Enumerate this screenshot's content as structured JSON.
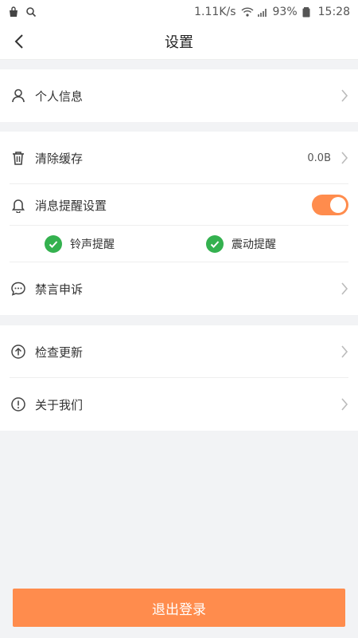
{
  "status_bar": {
    "speed": "1.11K/s",
    "battery": "93%",
    "time": "15:28",
    "icons": [
      "shopping-bag-icon",
      "search-icon",
      "wifi-icon",
      "signal-icon",
      "battery-icon"
    ]
  },
  "header": {
    "title": "设置"
  },
  "groups": {
    "profile": {
      "label": "个人信息"
    },
    "cache": {
      "label": "清除缓存",
      "value": "0.0B"
    },
    "notifications": {
      "label": "消息提醒设置",
      "toggle_on": true,
      "options": [
        {
          "label": "铃声提醒",
          "checked": true
        },
        {
          "label": "震动提醒",
          "checked": true
        }
      ]
    },
    "appeal": {
      "label": "禁言申诉"
    },
    "update": {
      "label": "检查更新"
    },
    "about": {
      "label": "关于我们"
    }
  },
  "logout": {
    "label": "退出登录"
  },
  "colors": {
    "accent": "#ff8c4d",
    "check_green": "#34b14f",
    "background": "#f2f3f5"
  }
}
